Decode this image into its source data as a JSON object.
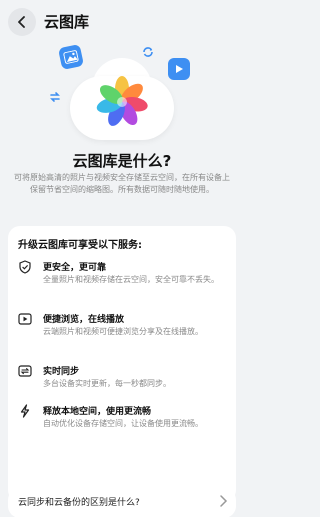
{
  "header": {
    "title": "云图库"
  },
  "intro": {
    "headline": "云图库是什么?",
    "description": "可将原始高清的照片与视频安全存储至云空间，在所有设备上保留节省空间的缩略图。所有数据可随时随地使用。"
  },
  "services": {
    "title": "升级云图库可享受以下服务:",
    "items": [
      {
        "icon": "shield-check-icon",
        "title": "更安全，更可靠",
        "description": "全量照片和视频存储在云空间，安全可靠不丢失。"
      },
      {
        "icon": "play-icon",
        "title": "便捷浏览，在线播放",
        "description": "云端照片和视频可便捷浏览分享及在线播放。"
      },
      {
        "icon": "sync-icon",
        "title": "实时同步",
        "description": "多台设备实时更新，每一秒都同步。"
      },
      {
        "icon": "lightning-icon",
        "title": "释放本地空间，使用更流畅",
        "description": "自动优化设备存储空间，让设备使用更流畅。"
      }
    ]
  },
  "faq": {
    "label": "云同步和云备份的区别是什么?"
  },
  "colors": {
    "background": "#f1f3f5",
    "card": "#ffffff",
    "accent": "#3e8ff2"
  }
}
